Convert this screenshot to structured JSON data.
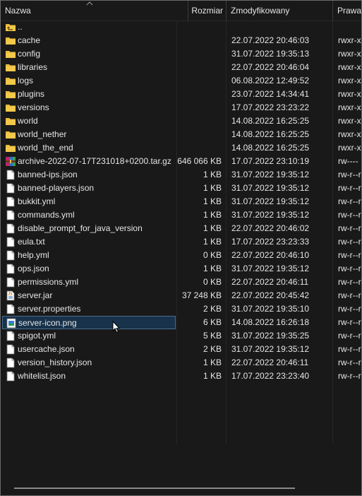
{
  "header": {
    "name": "Nazwa",
    "size": "Rozmiar",
    "modified": "Zmodyfikowany",
    "perms": "Prawa"
  },
  "rows": [
    {
      "icon": "parent-folder-icon",
      "name": "..",
      "size": "",
      "modified": "",
      "perms": ""
    },
    {
      "icon": "folder-icon",
      "name": "cache",
      "size": "",
      "modified": "22.07.2022 20:46:03",
      "perms": "rwxr-x"
    },
    {
      "icon": "folder-icon",
      "name": "config",
      "size": "",
      "modified": "31.07.2022 19:35:13",
      "perms": "rwxr-x"
    },
    {
      "icon": "folder-icon",
      "name": "libraries",
      "size": "",
      "modified": "22.07.2022 20:46:04",
      "perms": "rwxr-x"
    },
    {
      "icon": "folder-icon",
      "name": "logs",
      "size": "",
      "modified": "06.08.2022 12:49:52",
      "perms": "rwxr-x"
    },
    {
      "icon": "folder-icon",
      "name": "plugins",
      "size": "",
      "modified": "23.07.2022 14:34:41",
      "perms": "rwxr-x"
    },
    {
      "icon": "folder-icon",
      "name": "versions",
      "size": "",
      "modified": "17.07.2022 23:23:22",
      "perms": "rwxr-x"
    },
    {
      "icon": "folder-icon",
      "name": "world",
      "size": "",
      "modified": "14.08.2022 16:25:25",
      "perms": "rwxr-x"
    },
    {
      "icon": "folder-icon",
      "name": "world_nether",
      "size": "",
      "modified": "14.08.2022 16:25:25",
      "perms": "rwxr-x"
    },
    {
      "icon": "folder-icon",
      "name": "world_the_end",
      "size": "",
      "modified": "14.08.2022 16:25:25",
      "perms": "rwxr-x"
    },
    {
      "icon": "archive-icon",
      "name": "archive-2022-07-17T231018+0200.tar.gz",
      "size": "646 066 KB",
      "modified": "17.07.2022 23:10:19",
      "perms": "rw----"
    },
    {
      "icon": "file-icon",
      "name": "banned-ips.json",
      "size": "1 KB",
      "modified": "31.07.2022 19:35:12",
      "perms": "rw-r--r"
    },
    {
      "icon": "file-icon",
      "name": "banned-players.json",
      "size": "1 KB",
      "modified": "31.07.2022 19:35:12",
      "perms": "rw-r--r"
    },
    {
      "icon": "file-icon",
      "name": "bukkit.yml",
      "size": "1 KB",
      "modified": "31.07.2022 19:35:12",
      "perms": "rw-r--r"
    },
    {
      "icon": "file-icon",
      "name": "commands.yml",
      "size": "1 KB",
      "modified": "31.07.2022 19:35:12",
      "perms": "rw-r--r"
    },
    {
      "icon": "file-icon",
      "name": "disable_prompt_for_java_version",
      "size": "1 KB",
      "modified": "22.07.2022 20:46:02",
      "perms": "rw-r--r"
    },
    {
      "icon": "file-icon",
      "name": "eula.txt",
      "size": "1 KB",
      "modified": "17.07.2022 23:23:33",
      "perms": "rw-r--r"
    },
    {
      "icon": "file-icon",
      "name": "help.yml",
      "size": "0 KB",
      "modified": "22.07.2022 20:46:10",
      "perms": "rw-r--r"
    },
    {
      "icon": "file-icon",
      "name": "ops.json",
      "size": "1 KB",
      "modified": "31.07.2022 19:35:12",
      "perms": "rw-r--r"
    },
    {
      "icon": "file-icon",
      "name": "permissions.yml",
      "size": "0 KB",
      "modified": "22.07.2022 20:46:11",
      "perms": "rw-r--r"
    },
    {
      "icon": "jar-icon",
      "name": "server.jar",
      "size": "37 248 KB",
      "modified": "22.07.2022 20:45:42",
      "perms": "rw-r--r"
    },
    {
      "icon": "file-icon",
      "name": "server.properties",
      "size": "2 KB",
      "modified": "31.07.2022 19:35:10",
      "perms": "rw-r--r"
    },
    {
      "icon": "image-icon",
      "name": "server-icon.png",
      "size": "6 KB",
      "modified": "14.08.2022 16:26:18",
      "perms": "rw-r--r",
      "selected": true
    },
    {
      "icon": "file-icon",
      "name": "spigot.yml",
      "size": "5 KB",
      "modified": "31.07.2022 19:35:25",
      "perms": "rw-r--r"
    },
    {
      "icon": "file-icon",
      "name": "usercache.json",
      "size": "2 KB",
      "modified": "31.07.2022 19:35:12",
      "perms": "rw-r--r"
    },
    {
      "icon": "file-icon",
      "name": "version_history.json",
      "size": "1 KB",
      "modified": "22.07.2022 20:46:11",
      "perms": "rw-r--r"
    },
    {
      "icon": "file-icon",
      "name": "whitelist.json",
      "size": "1 KB",
      "modified": "17.07.2022 23:23:40",
      "perms": "rw-r--r"
    }
  ],
  "colors": {
    "background": "#191919",
    "text": "#e6e6e6",
    "folder": "#e8b93a",
    "selection": "#17324a"
  }
}
